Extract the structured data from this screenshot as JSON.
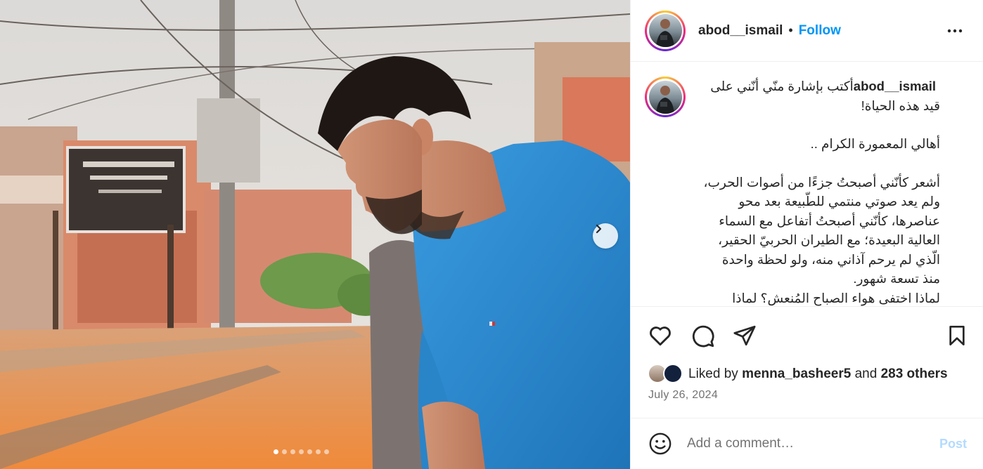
{
  "post": {
    "username": "abod__ismail",
    "bullet": "•",
    "follow_label": "Follow",
    "carousel": {
      "count": 7,
      "active_index": 0
    }
  },
  "caption": {
    "username": "abod__ismail",
    "paragraphs": [
      "أكتب بإشارة منّي أنّني على قيد هذه الحياة!",
      "أهالي المعمورة الكرام ..",
      "أشعر كأنّني أصبحتُ جزءًا من أصوات الحرب، ولم يعد صوتي منتمي للطّبيعة بعد محو عناصرها، كأنّني أصبحتُ أتفاعل مع السماء العالية البعيدة؛ مع الطيران الحربيّ الحقير، الّذي لم يرحم آذاني منه، ولو لحظة واحدة منذ تسعة شهور.\nلماذا اختفى هواء الصباح المُنعش؟ لماذا"
    ]
  },
  "likes": {
    "prefix": "Liked by",
    "user": "menna_basheer5",
    "and": "and",
    "others": "283 others"
  },
  "date": "July 26, 2024",
  "comment": {
    "placeholder": "Add a comment…",
    "post_label": "Post"
  },
  "icons": {
    "more": "more-options-icon",
    "like": "heart-icon",
    "comment": "comment-icon",
    "share": "share-icon",
    "save": "bookmark-icon",
    "emoji": "emoji-icon",
    "next": "chevron-right-icon"
  },
  "colors": {
    "follow": "#0095f6",
    "post_disabled": "#b3dbff",
    "text": "#262626",
    "muted": "#737373",
    "shirt": "#2f8fd4"
  }
}
